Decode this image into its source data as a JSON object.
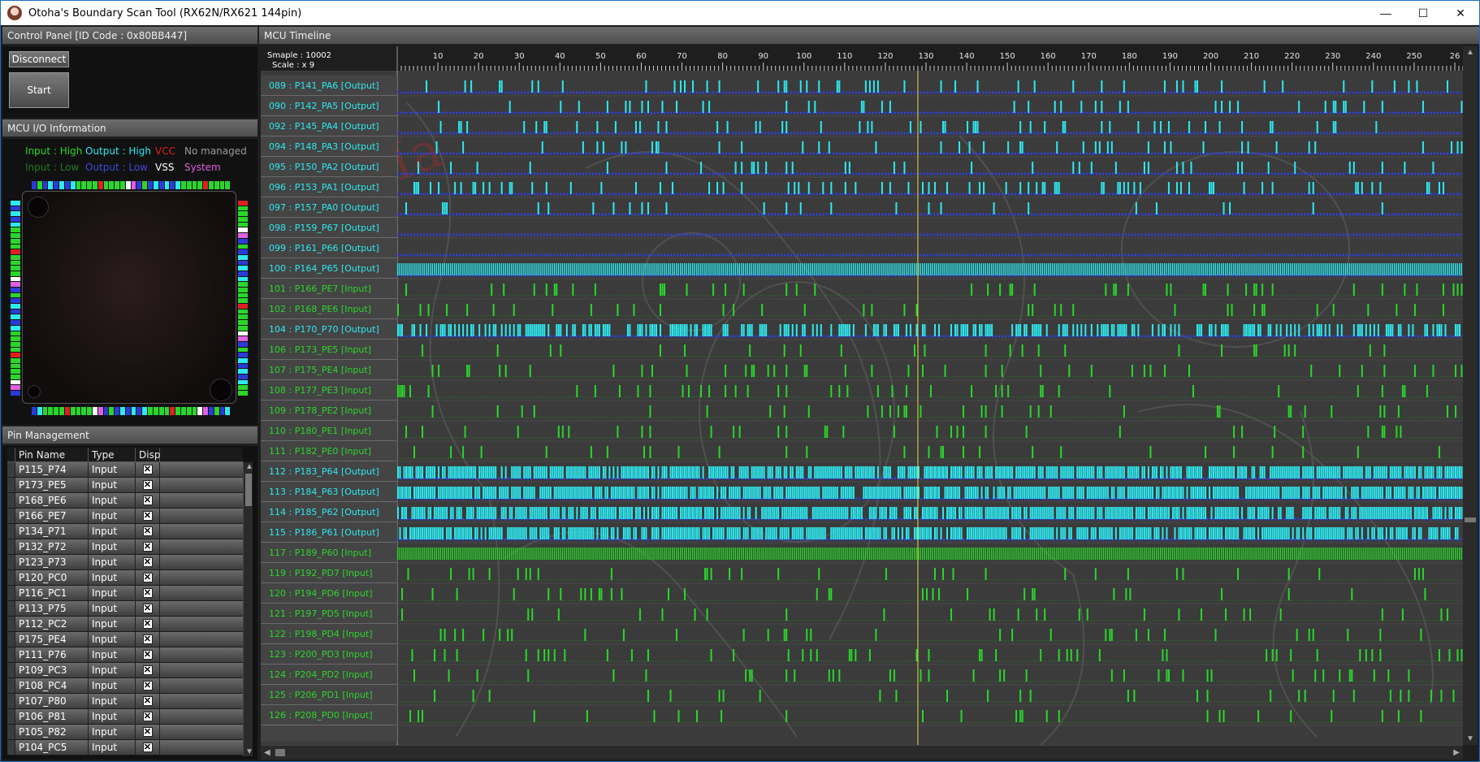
{
  "window": {
    "title": "Otoha's Boundary Scan Tool (RX62N/RX621 144pin)",
    "minimize": "—",
    "maximize": "☐",
    "close": "✕"
  },
  "control_panel": {
    "title": "Control Panel  [ID Code : 0x80BB447]",
    "disconnect_label": "Disconnect",
    "start_label": "Start"
  },
  "io_info": {
    "title": "MCU I/O Information",
    "legend": [
      {
        "text": "Input : High",
        "color": "#2bd62b"
      },
      {
        "text": "Output : High",
        "color": "#2ee9f0"
      },
      {
        "text": "VCC",
        "color": "#e02020"
      },
      {
        "text": "No managed",
        "color": "#9a9a9a"
      },
      {
        "text": "Input : Low",
        "color": "#1f7a1f"
      },
      {
        "text": "Output : Low",
        "color": "#3b4bd6"
      },
      {
        "text": "VSS",
        "color": "#ffffff"
      },
      {
        "text": "System",
        "color": "#e060e0"
      }
    ]
  },
  "pin_management": {
    "title": "Pin Management",
    "columns": [
      "Pin Name",
      "Type",
      "Disp"
    ],
    "rows": [
      {
        "name": "P115_P74",
        "type": "Input",
        "disp": "✕"
      },
      {
        "name": "P173_PE5",
        "type": "Input",
        "disp": "✕"
      },
      {
        "name": "P168_PE6",
        "type": "Input",
        "disp": "✕"
      },
      {
        "name": "P166_PE7",
        "type": "Input",
        "disp": "✕"
      },
      {
        "name": "P134_P71",
        "type": "Input",
        "disp": "✕"
      },
      {
        "name": "P132_P72",
        "type": "Input",
        "disp": "✕"
      },
      {
        "name": "P123_P73",
        "type": "Input",
        "disp": "✕"
      },
      {
        "name": "P120_PC0",
        "type": "Input",
        "disp": "✕"
      },
      {
        "name": "P116_PC1",
        "type": "Input",
        "disp": "✕"
      },
      {
        "name": "P113_P75",
        "type": "Input",
        "disp": "✕"
      },
      {
        "name": "P112_PC2",
        "type": "Input",
        "disp": "✕"
      },
      {
        "name": "P175_PE4",
        "type": "Input",
        "disp": "✕"
      },
      {
        "name": "P111_P76",
        "type": "Input",
        "disp": "✕"
      },
      {
        "name": "P109_PC3",
        "type": "Input",
        "disp": "✕"
      },
      {
        "name": "P108_PC4",
        "type": "Input",
        "disp": "✕"
      },
      {
        "name": "P107_P80",
        "type": "Input",
        "disp": "✕"
      },
      {
        "name": "P106_P81",
        "type": "Input",
        "disp": "✕"
      },
      {
        "name": "P105_P82",
        "type": "Input",
        "disp": "✕"
      },
      {
        "name": "P104_PC5",
        "type": "Input",
        "disp": "✕"
      }
    ]
  },
  "timeline": {
    "title": "MCU Timeline",
    "sample_label": "Smaple :  10002",
    "scale_label": "Scale : x 9",
    "ticks": [
      "10",
      "20",
      "30",
      "40",
      "50",
      "60",
      "70",
      "80",
      "90",
      "100",
      "110",
      "120",
      "130",
      "140",
      "150",
      "160",
      "170",
      "180",
      "190",
      "200",
      "210",
      "220",
      "230",
      "240",
      "250",
      "26"
    ],
    "cursor_sample": 128,
    "signals": [
      {
        "label": "089 : P141_PA6 [Output]",
        "kind": "output",
        "density": 0.08,
        "seed": 3
      },
      {
        "label": "090 : P142_PA5 [Output]",
        "kind": "output",
        "density": 0.07,
        "seed": 7
      },
      {
        "label": "092 : P145_PA4 [Output]",
        "kind": "output",
        "density": 0.09,
        "seed": 11
      },
      {
        "label": "094 : P148_PA3 [Output]",
        "kind": "output",
        "density": 0.07,
        "seed": 17
      },
      {
        "label": "095 : P150_PA2 [Output]",
        "kind": "output",
        "density": 0.08,
        "seed": 23
      },
      {
        "label": "096 : P153_PA1 [Output]",
        "kind": "output",
        "density": 0.15,
        "seed": 29
      },
      {
        "label": "097 : P157_PA0 [Output]",
        "kind": "output",
        "density": 0.05,
        "seed": 31
      },
      {
        "label": "098 : P159_P67 [Output]",
        "kind": "output",
        "density": 0.0,
        "seed": 37
      },
      {
        "label": "099 : P161_P66 [Output]",
        "kind": "output",
        "density": 0.0,
        "seed": 41
      },
      {
        "label": "100 : P164_P65 [Output]",
        "kind": "output",
        "density": 1.0,
        "seed": 43
      },
      {
        "label": "101 : P166_PE7 [Input]",
        "kind": "input",
        "density": 0.07,
        "seed": 47
      },
      {
        "label": "102 : P168_PE6 [Input]",
        "kind": "input",
        "density": 0.07,
        "seed": 53
      },
      {
        "label": "104 : P170_P70 [Output]",
        "kind": "output",
        "density": 0.5,
        "seed": 59
      },
      {
        "label": "106 : P173_PE5 [Input]",
        "kind": "input",
        "density": 0.06,
        "seed": 61
      },
      {
        "label": "107 : P175_PE4 [Input]",
        "kind": "input",
        "density": 0.06,
        "seed": 67
      },
      {
        "label": "108 : P177_PE3 [Input]",
        "kind": "input",
        "density": 0.07,
        "seed": 71
      },
      {
        "label": "109 : P178_PE2 [Input]",
        "kind": "input",
        "density": 0.07,
        "seed": 73
      },
      {
        "label": "110 : P180_PE1 [Input]",
        "kind": "input",
        "density": 0.07,
        "seed": 79
      },
      {
        "label": "111 : P182_PE0 [Input]",
        "kind": "input",
        "density": 0.05,
        "seed": 83
      },
      {
        "label": "112 : P183_P64 [Output]",
        "kind": "output",
        "density": 0.85,
        "seed": 89
      },
      {
        "label": "113 : P184_P63 [Output]",
        "kind": "output",
        "density": 0.85,
        "seed": 97
      },
      {
        "label": "114 : P185_P62 [Output]",
        "kind": "output",
        "density": 0.8,
        "seed": 101
      },
      {
        "label": "115 : P186_P61 [Output]",
        "kind": "output",
        "density": 0.8,
        "seed": 103
      },
      {
        "label": "117 : P189_P60 [Input]",
        "kind": "input",
        "density": 1.0,
        "seed": 107
      },
      {
        "label": "119 : P192_PD7 [Input]",
        "kind": "input",
        "density": 0.07,
        "seed": 109
      },
      {
        "label": "120 : P194_PD6 [Input]",
        "kind": "input",
        "density": 0.07,
        "seed": 113
      },
      {
        "label": "121 : P197_PD5 [Input]",
        "kind": "input",
        "density": 0.06,
        "seed": 127
      },
      {
        "label": "122 : P198_PD4 [Input]",
        "kind": "input",
        "density": 0.07,
        "seed": 131
      },
      {
        "label": "123 : P200_PD3 [Input]",
        "kind": "input",
        "density": 0.07,
        "seed": 137
      },
      {
        "label": "124 : P204_PD2 [Input]",
        "kind": "input",
        "density": 0.07,
        "seed": 139
      },
      {
        "label": "125 : P206_PD1 [Input]",
        "kind": "input",
        "density": 0.05,
        "seed": 149
      },
      {
        "label": "126 : P208_PD0 [Input]",
        "kind": "input",
        "density": 0.05,
        "seed": 151
      }
    ]
  },
  "colors": {
    "output_high": "#2ee9f0",
    "output_low": "#2f3fe0",
    "input_high": "#2bd62b",
    "input_low": "#1f8a1f",
    "cursor": "#e8d84a"
  }
}
